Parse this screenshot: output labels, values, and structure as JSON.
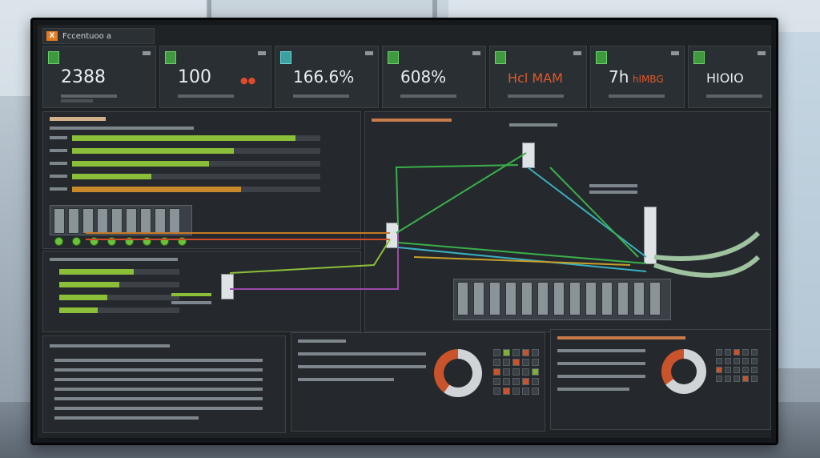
{
  "app": {
    "title": "Fccentuoo a",
    "logo": "X"
  },
  "kpis": [
    {
      "value": "2388",
      "icon": "app-icon"
    },
    {
      "value": "100",
      "icon": "app-icon"
    },
    {
      "value": "166.6%",
      "icon": "app-icon"
    },
    {
      "value": "608%",
      "icon": "app-icon"
    },
    {
      "value": "Hcl MAM",
      "icon": "app-icon"
    },
    {
      "value": "7h",
      "suffix": "hlMBG",
      "icon": "app-icon"
    },
    {
      "value": "HIOIO",
      "icon": "app-icon"
    }
  ],
  "bars": [
    0.9,
    0.65,
    0.55,
    0.32,
    0.68
  ],
  "bars2": [
    0.62,
    0.5,
    0.4,
    0.32
  ],
  "colors": {
    "accent_green": "#8bbf3a",
    "accent_orange": "#c7892a",
    "accent_red": "#e05a2b",
    "panel_bg": "#25292d"
  }
}
